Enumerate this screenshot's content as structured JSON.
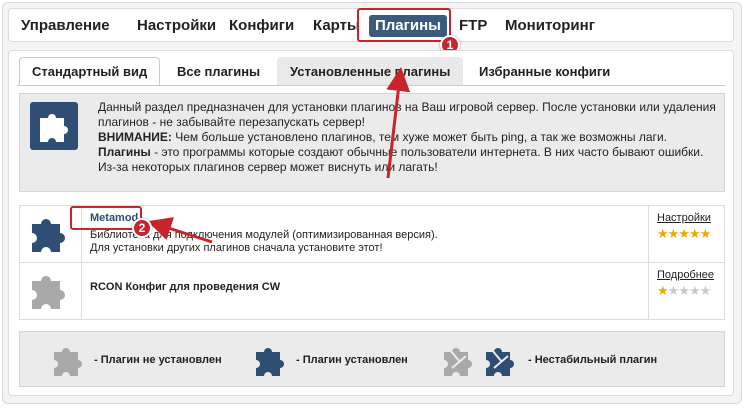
{
  "topnav": {
    "items": [
      "Управление",
      "Настройки",
      "Конфиги",
      "Карты",
      "Плагины",
      "FTP",
      "Мониторинг"
    ],
    "active_index": 4
  },
  "subtabs": {
    "items": [
      "Стандартный вид",
      "Все плагины",
      "Установленные плагины",
      "Избранные конфиги"
    ],
    "active_index": 0
  },
  "info": {
    "line1": "Данный раздел предназначен для установки плагинов на Ваш игровой сервер. После установки или удаления плагинов - не забывайте перезапускать сервер!",
    "warning_label": "ВНИМАНИЕ:",
    "warning_text": " Чем больше установлено плагинов, тем хуже может быть ping, а так же возможны лаги.",
    "plugins_label": "Плагины",
    "plugins_text": " - это программы которые создают обычные пользователи интернета. В них часто бывают ошибки. Из-за некоторых плагинов сервер может виснуть или лагать!"
  },
  "plugins": [
    {
      "name": "Metamod",
      "desc1": "Библиотека для подключения модулей (оптимизированная версия).",
      "desc2": "Для установки других плагинов сначала установите этот!",
      "link": "Настройки",
      "rating": 5,
      "installed": true
    },
    {
      "name": "RCON Конфиг для проведения CW",
      "desc1": "",
      "desc2": "",
      "link": "Подробнее",
      "rating": 1,
      "installed": false
    }
  ],
  "legend": {
    "not_installed": "- Плагин не установлен",
    "installed": "- Плагин установлен",
    "unstable": "- Нестабильный плагин"
  },
  "annotations": {
    "badge1": "1",
    "badge2": "2"
  },
  "colors": {
    "accent": "#3a5b7c",
    "highlight": "#c8242b",
    "star": "#f0a800"
  }
}
